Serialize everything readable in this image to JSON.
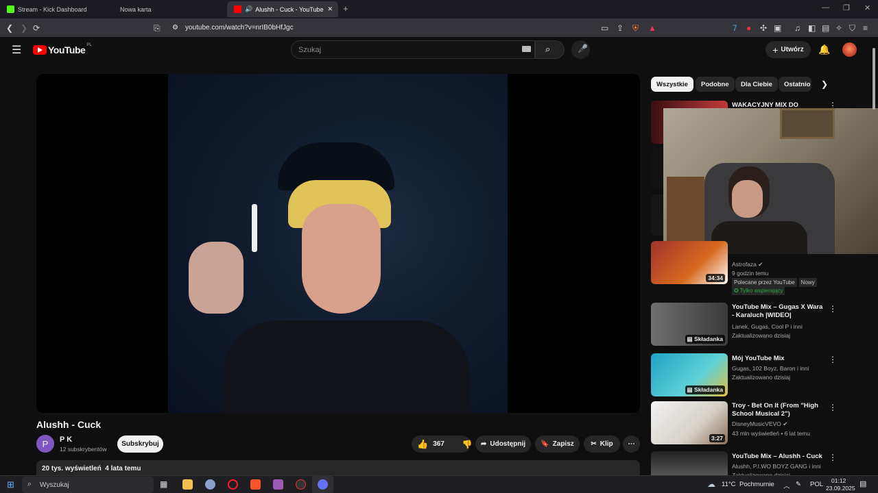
{
  "browser": {
    "tabs": [
      {
        "label": "Stream - Kick Dashboard",
        "color": "#53fc18"
      },
      {
        "label": "Nowa karta",
        "color": ""
      },
      {
        "label": "Alushh - Cuck - YouTube",
        "color": "#ff0000"
      }
    ],
    "url": "youtube.com/watch?v=nrIB0bHfJgc"
  },
  "youtube": {
    "logo": "YouTube",
    "region": "PL",
    "search_placeholder": "Szukaj",
    "create_label": "Utwórz"
  },
  "video": {
    "title": "Alushh - Cuck",
    "channel": "P K",
    "channel_initial": "P",
    "subscribers": "12 subskrybentów",
    "subscribe_label": "Subskrybuj",
    "likes": "367",
    "share_label": "Udostępnij",
    "save_label": "Zapisz",
    "clip_label": "Klip",
    "views": "20 tys. wyświetleń",
    "age": "4 lata temu"
  },
  "sidebar": {
    "chips": [
      "Wszystkie",
      "Podobne",
      "Dla Ciebie",
      "Ostatnio"
    ],
    "items": [
      {
        "title": "WAKACYJNY MIX DO",
        "channel": "",
        "meta": "",
        "duration": ""
      },
      {
        "title": "",
        "channel": "Astrofaza",
        "meta": "9 godzin temu",
        "badge1": "Polecane przez YouTube",
        "badge2": "Nowy",
        "badge3": "Tylko wspierający",
        "duration": "34:34"
      },
      {
        "title": "YouTube Mix – Gugas X Wara - Karaluch |WIDEO|",
        "channel": "Lanek, Gugas, Cool P i inni",
        "meta": "Zaktualizowano dzisiaj",
        "duration": "Składanka"
      },
      {
        "title": "Mój YouTube Mix",
        "channel": "Gugas, 102 Boyz, Baron i inni",
        "meta": "Zaktualizowano dzisiaj",
        "duration": "Składanka"
      },
      {
        "title": "Troy - Bet On It (From \"High School Musical 2\")",
        "channel": "DisneyMusicVEVO",
        "meta": "43 mln wyświetleń • 6 lat temu",
        "duration": "3:27"
      },
      {
        "title": "YouTube Mix – Alushh - Cuck",
        "channel": "Alushh, P.I.WO BOYZ GANG i inni",
        "meta": "Zaktualizowano dzisiaj",
        "duration": ""
      }
    ]
  },
  "taskbar": {
    "search_label": "Wyszukaj",
    "weather": "11°C",
    "weather_desc": "Pochmurnie",
    "lang": "POL",
    "time": "01:12",
    "date": "23.09.2025"
  }
}
